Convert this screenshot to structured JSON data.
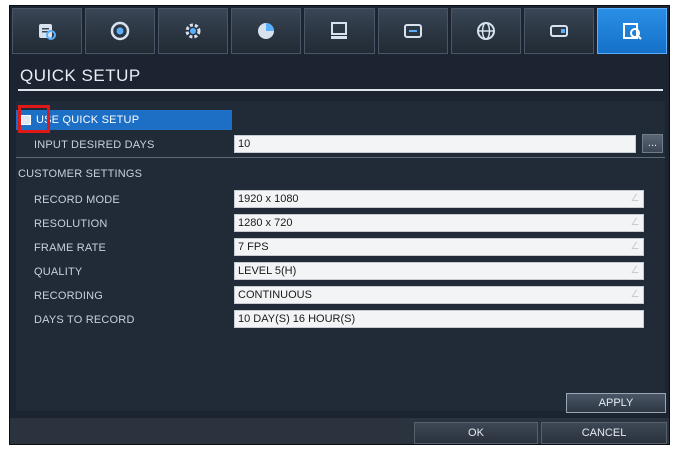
{
  "tabs": [
    {
      "icon": "search-list-icon",
      "active": false
    },
    {
      "icon": "record-icon",
      "active": false
    },
    {
      "icon": "gear-icon",
      "active": false
    },
    {
      "icon": "pie-chart-icon",
      "active": false
    },
    {
      "icon": "monitor-icon",
      "active": false
    },
    {
      "icon": "display-icon",
      "active": false
    },
    {
      "icon": "globe-icon",
      "active": false
    },
    {
      "icon": "drive-icon",
      "active": false
    },
    {
      "icon": "magnifier-search-icon",
      "active": true
    }
  ],
  "header": {
    "title": "QUICK SETUP"
  },
  "quick_setup": {
    "label": "USE QUICK SETUP",
    "input_days_label": "INPUT DESIRED DAYS",
    "input_days_value": "10",
    "dots_label": "..."
  },
  "customer": {
    "section_label": "CUSTOMER SETTINGS",
    "rows": [
      {
        "label": "RECORD MODE",
        "value": "1920 x 1080"
      },
      {
        "label": "RESOLUTION",
        "value": "1280 x 720"
      },
      {
        "label": "FRAME RATE",
        "value": "7 FPS"
      },
      {
        "label": "QUALITY",
        "value": "LEVEL 5(H)"
      },
      {
        "label": "RECORDING",
        "value": "CONTINUOUS"
      },
      {
        "label": "DAYS TO RECORD",
        "value": "10 DAY(S) 16 HOUR(S)"
      }
    ]
  },
  "buttons": {
    "apply": "APPLY",
    "ok": "OK",
    "cancel": "CANCEL"
  },
  "colors": {
    "background": "#1b2430",
    "accent": "#1d6fc6",
    "highlight": "#e01818"
  }
}
